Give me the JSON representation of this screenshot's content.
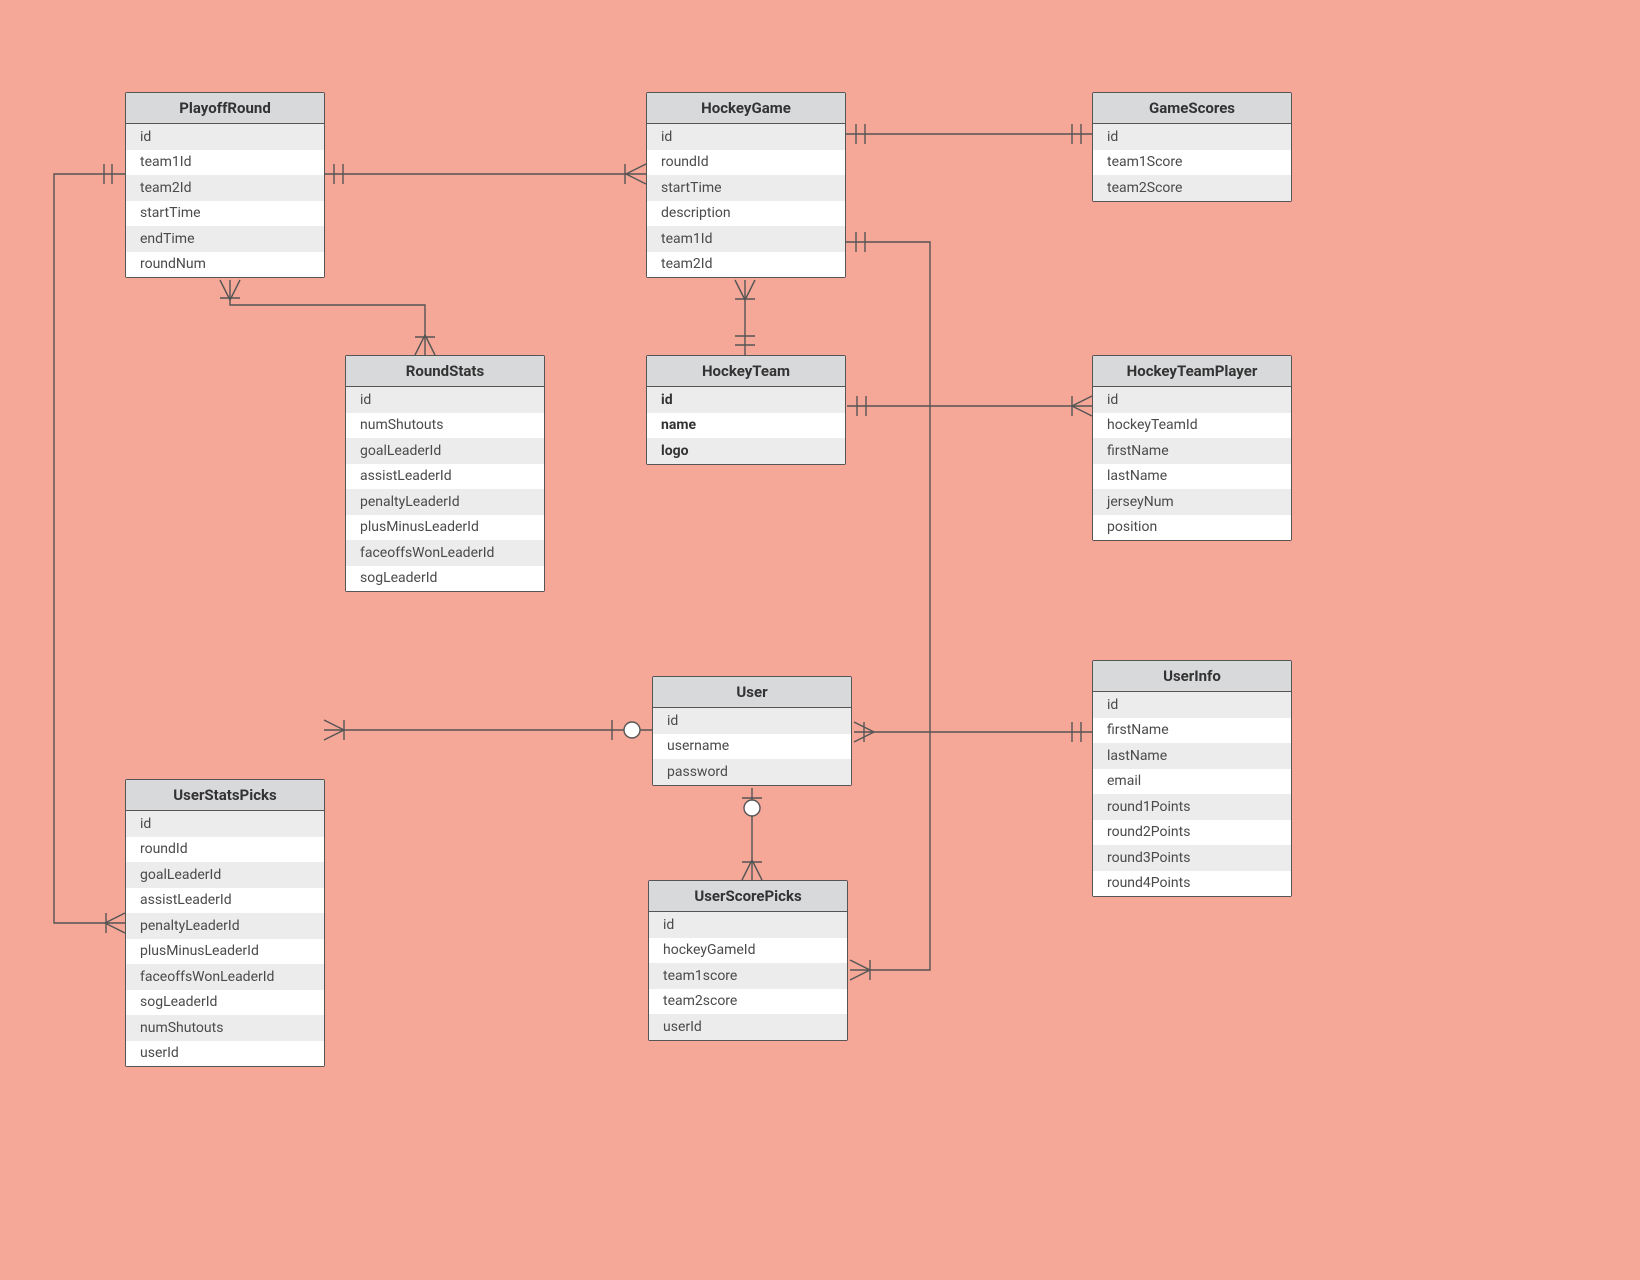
{
  "entities": {
    "playoffRound": {
      "title": "PlayoffRound",
      "fields": [
        "id",
        "team1Id",
        "team2Id",
        "startTime",
        "endTime",
        "roundNum"
      ]
    },
    "hockeyGame": {
      "title": "HockeyGame",
      "fields": [
        "id",
        "roundId",
        "startTime",
        "description",
        "team1Id",
        "team2Id"
      ]
    },
    "gameScores": {
      "title": "GameScores",
      "fields": [
        "id",
        "team1Score",
        "team2Score"
      ]
    },
    "roundStats": {
      "title": "RoundStats",
      "fields": [
        "id",
        "numShutouts",
        "goalLeaderId",
        "assistLeaderId",
        "penaltyLeaderId",
        "plusMinusLeaderId",
        "faceoffsWonLeaderId",
        "sogLeaderId"
      ]
    },
    "hockeyTeam": {
      "title": "HockeyTeam",
      "fields": [
        "id",
        "name",
        "logo"
      ],
      "bold": true
    },
    "hockeyTeamPlayer": {
      "title": "HockeyTeamPlayer",
      "fields": [
        "id",
        "hockeyTeamId",
        "firstName",
        "lastName",
        "jerseyNum",
        "position"
      ]
    },
    "user": {
      "title": "User",
      "fields": [
        "id",
        "username",
        "password"
      ]
    },
    "userInfo": {
      "title": "UserInfo",
      "fields": [
        "id",
        "firstName",
        "lastName",
        "email",
        "round1Points",
        "round2Points",
        "round3Points",
        "round4Points"
      ]
    },
    "userStatsPicks": {
      "title": "UserStatsPicks",
      "fields": [
        "id",
        "roundId",
        "goalLeaderId",
        "assistLeaderId",
        "penaltyLeaderId",
        "plusMinusLeaderId",
        "faceoffsWonLeaderId",
        "sogLeaderId",
        "numShutouts",
        "userId"
      ]
    },
    "userScorePicks": {
      "title": "UserScorePicks",
      "fields": [
        "id",
        "hockeyGameId",
        "team1score",
        "team2score",
        "userId"
      ]
    }
  }
}
